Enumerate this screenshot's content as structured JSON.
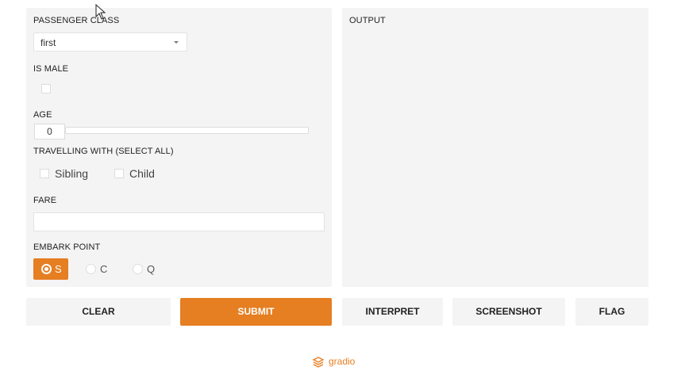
{
  "inputs": {
    "passenger_class": {
      "label": "PASSENGER CLASS",
      "value": "first"
    },
    "is_male": {
      "label": "IS MALE",
      "checked": false
    },
    "age": {
      "label": "AGE",
      "value": "0"
    },
    "travelling_with": {
      "label": "TRAVELLING WITH (SELECT ALL)",
      "options": [
        "Sibling",
        "Child"
      ]
    },
    "fare": {
      "label": "FARE",
      "value": ""
    },
    "embark_point": {
      "label": "EMBARK POINT",
      "options": [
        "S",
        "C",
        "Q"
      ],
      "selected": "S"
    }
  },
  "output": {
    "label": "OUTPUT"
  },
  "buttons": {
    "clear": "CLEAR",
    "submit": "SUBMIT",
    "interpret": "INTERPRET",
    "screenshot": "SCREENSHOT",
    "flag": "FLAG"
  },
  "footer": {
    "brand": "gradio"
  },
  "colors": {
    "accent": "#e67e22",
    "panel": "#f4f4f4"
  },
  "icons": {
    "cursor": "arrow-cursor-icon",
    "logo": "gradio-logo-icon"
  }
}
